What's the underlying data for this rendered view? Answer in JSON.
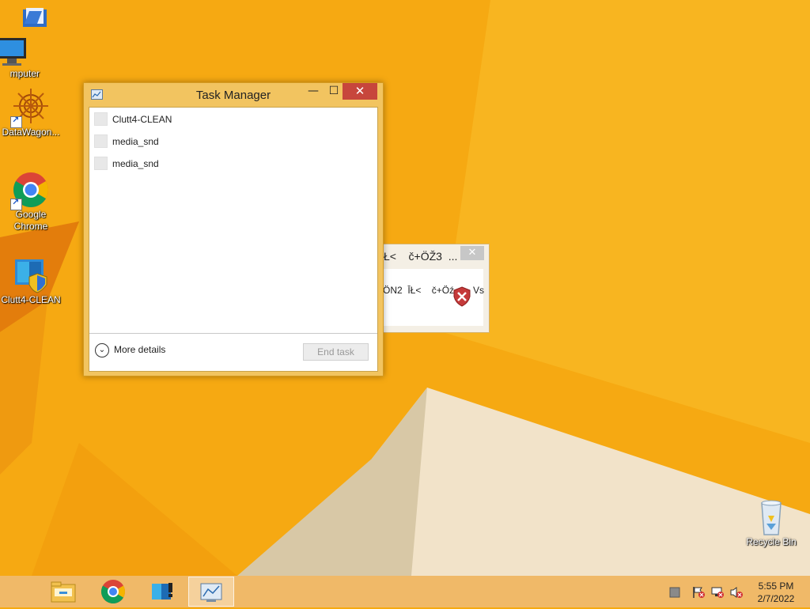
{
  "desktop": {
    "icons": [
      {
        "label": "",
        "icon": "network-folder-icon"
      },
      {
        "label": "mputer",
        "icon": "computer-icon"
      },
      {
        "label": "DataWagon...",
        "icon": "datawagon-icon"
      },
      {
        "label": "Google\nChrome",
        "icon": "chrome-icon"
      },
      {
        "label": "Clutt4-CLEAN",
        "icon": "clutt4-clean-icon"
      },
      {
        "label": "Recycle Bin",
        "icon": "recycle-bin-icon"
      }
    ]
  },
  "task_manager": {
    "title": "Task Manager",
    "buttons": {
      "minimize": "—",
      "maximize": "☐",
      "close": "✕"
    },
    "processes": [
      {
        "name": "Clutt4-CLEAN"
      },
      {
        "name": "media_snd"
      },
      {
        "name": "media_snd"
      }
    ],
    "more_details": "More details",
    "end_task": "End task"
  },
  "popup": {
    "title": "Ł<    č+ÖŽ3  ...",
    "close": "✕",
    "message": "ÖN2  ĪŁ<    č+Öź",
    "trailing": "Vs",
    "icon": "error-shield-icon"
  },
  "taskbar": {
    "buttons": [
      {
        "name": "file-explorer"
      },
      {
        "name": "google-chrome"
      },
      {
        "name": "clutt4-clean"
      },
      {
        "name": "task-manager",
        "active": true
      }
    ],
    "tray": [
      "action-center-icon",
      "network-icon",
      "volume-muted-icon"
    ],
    "time": "5:55 PM",
    "date": "2/7/2022"
  },
  "colors": {
    "accent": "#f7aa10",
    "close_red": "#c7463c"
  }
}
